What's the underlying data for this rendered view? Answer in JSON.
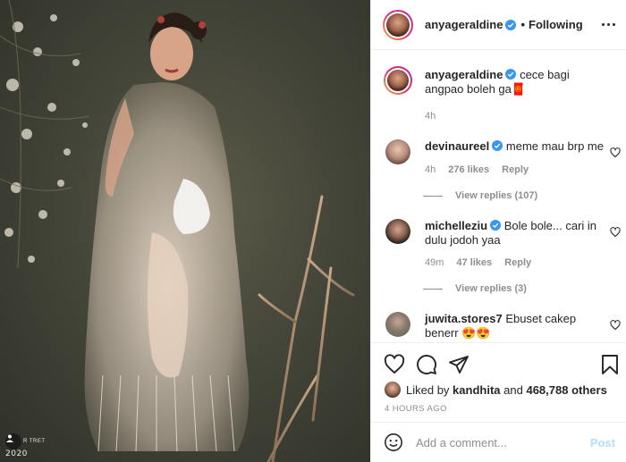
{
  "post": {
    "image_alt_icons": [
      "post-photo"
    ],
    "watermark": {
      "brand": "R   TRET",
      "year": "2020"
    }
  },
  "header": {
    "username": "anyageraldine",
    "separator": "•",
    "follow_label": "Following"
  },
  "caption": {
    "username": "anyageraldine",
    "text": "cece bagi angpao boleh ga",
    "emoji": "🧧",
    "time": "4h"
  },
  "comments": [
    {
      "username": "devinaureel",
      "text": "meme mau brp me",
      "time": "4h",
      "likes": "276 likes",
      "reply": "Reply",
      "view_replies": "View replies (107)"
    },
    {
      "username": "michelleziu",
      "text": "Bole bole... cari in dulu jodoh yaa",
      "time": "49m",
      "likes": "47 likes",
      "reply": "Reply",
      "view_replies": "View replies (3)"
    },
    {
      "username": "juwita.stores7",
      "text": "Ebuset cakep benerr 😍😍"
    }
  ],
  "likes": {
    "prefix": "Liked by",
    "user": "kandhita",
    "joiner": "and",
    "count": "468,788 others"
  },
  "timestamp": "4 HOURS AGO",
  "add_comment": {
    "placeholder": "Add a comment...",
    "post_label": "Post"
  },
  "colors": {
    "verified": "#3897f0",
    "post_disabled": "#b2dffc",
    "muted_text": "#8e8e8e"
  }
}
